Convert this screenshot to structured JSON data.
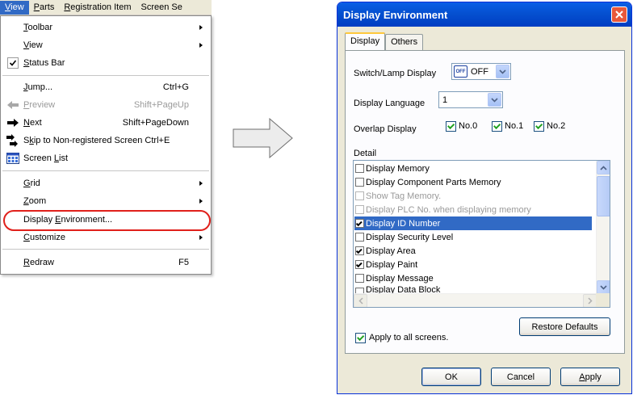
{
  "menubar": {
    "items": [
      {
        "label": "View",
        "mnemonic": "V",
        "rest": "iew"
      },
      {
        "label": "Parts",
        "mnemonic": "P",
        "rest": "arts"
      },
      {
        "label": "Registration Item",
        "mnemonic": "R",
        "rest": "egistration Item"
      },
      {
        "label": "Screen Se",
        "mnemonic": "",
        "rest": "Screen Se"
      }
    ]
  },
  "menu": {
    "toolbar": {
      "mnemonic": "T",
      "rest": "oolbar"
    },
    "view": {
      "mnemonic": "V",
      "rest": "iew"
    },
    "status_bar": {
      "mnemonic": "S",
      "rest": "tatus Bar"
    },
    "jump": {
      "mnemonic": "J",
      "rest": "ump...",
      "shortcut": "Ctrl+G"
    },
    "preview": {
      "mnemonic": "P",
      "rest": "review",
      "shortcut": "Shift+PageUp"
    },
    "next": {
      "mnemonic": "N",
      "rest": "ext",
      "shortcut": "Shift+PageDown"
    },
    "skip": {
      "pre": "S",
      "mnemonic": "k",
      "rest": "ip to Non-registered Screen Ctrl+E"
    },
    "screen_list": {
      "pre": "Screen ",
      "mnemonic": "L",
      "rest": "ist"
    },
    "grid": {
      "mnemonic": "G",
      "rest": "rid"
    },
    "zoom": {
      "mnemonic": "Z",
      "rest": "oom"
    },
    "display_environment": {
      "pre": "Display ",
      "mnemonic": "E",
      "rest": "nvironment..."
    },
    "customize": {
      "mnemonic": "C",
      "rest": "ustomize"
    },
    "redraw": {
      "mnemonic": "R",
      "rest": "edraw",
      "shortcut": "F5"
    }
  },
  "dialog": {
    "title": "Display Environment",
    "tabs": [
      "Display",
      "Others"
    ],
    "switch_lamp_label": "Switch/Lamp Display",
    "switch_lamp_value": "OFF",
    "switch_lamp_icon_text": "OFF",
    "language_label": "Display Language",
    "language_value": "1",
    "overlap_label": "Overlap Display",
    "overlap_options": [
      "No.0",
      "No.1",
      "No.2"
    ],
    "detail_label": "Detail",
    "detail_items": [
      {
        "label": "Display Memory",
        "checked": false,
        "enabled": true
      },
      {
        "label": "Display Component Parts Memory",
        "checked": false,
        "enabled": true
      },
      {
        "label": "Show Tag Memory.",
        "checked": false,
        "enabled": false
      },
      {
        "label": "Display PLC No. when displaying memory",
        "checked": false,
        "enabled": false
      },
      {
        "label": "Display ID Number",
        "checked": true,
        "enabled": true
      },
      {
        "label": "Display Security Level",
        "checked": false,
        "enabled": true
      },
      {
        "label": "Display Area",
        "checked": true,
        "enabled": true
      },
      {
        "label": "Display Paint",
        "checked": true,
        "enabled": true
      },
      {
        "label": "Display Message",
        "checked": false,
        "enabled": true
      },
      {
        "label": "Display Data Block",
        "checked": false,
        "enabled": true
      }
    ],
    "restore_defaults": "Restore Defaults",
    "apply_all": "Apply to all screens.",
    "ok": "OK",
    "cancel": "Cancel",
    "apply": "Apply",
    "apply_mnemonic": "A",
    "apply_rest": "pply"
  },
  "colors": {
    "accent": "#316ac5",
    "highlight_ring": "#e0201b",
    "title_bar": "#0550d0"
  }
}
